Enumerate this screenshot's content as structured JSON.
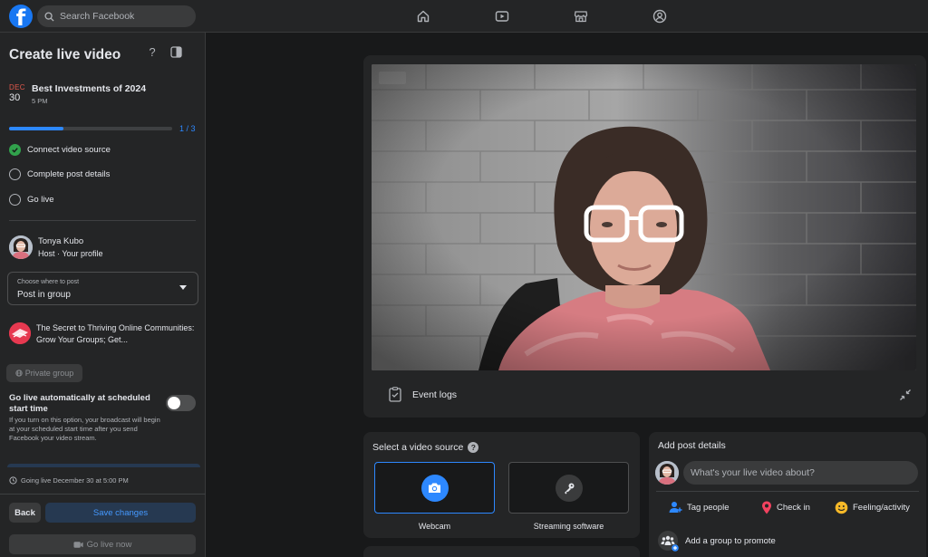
{
  "topbar": {
    "logo_letter": "f",
    "search_placeholder": "Search Facebook",
    "nav_icons": [
      "home-icon",
      "video-icon",
      "marketplace-icon",
      "groups-icon"
    ]
  },
  "sidebar": {
    "title": "Create live video",
    "help_label": "?",
    "event": {
      "month": "DEC",
      "day": "30",
      "name": "Best Investments of 2024",
      "time": "5 PM"
    },
    "progress": {
      "text": "1 / 3",
      "fraction": 0.3333
    },
    "steps": [
      {
        "label": "Connect video source",
        "done": true
      },
      {
        "label": "Complete post details",
        "done": false
      },
      {
        "label": "Go live",
        "done": false
      }
    ],
    "host": {
      "name": "Tonya Kubo",
      "role": "Host · Your profile"
    },
    "post_where": {
      "caption": "Choose where to post",
      "value": "Post in group"
    },
    "group": {
      "name": "The Secret to Thriving Online Communities: Grow Your Groups; Get..."
    },
    "private_label": "Private group",
    "auto_live": {
      "label": "Go live automatically at scheduled start time",
      "description": "If you turn on this option, your broadcast will begin at your scheduled start time after you send Facebook your video stream.",
      "enabled": false
    },
    "going_live": "Going live December 30 at 5:00 PM",
    "buttons": {
      "back": "Back",
      "save": "Save changes",
      "go_live": "Go live now"
    }
  },
  "preview": {
    "event_logs": "Event logs"
  },
  "video_source": {
    "title": "Select a video source",
    "help": "?",
    "options": [
      {
        "label": "Webcam",
        "selected": true
      },
      {
        "label": "Streaming software",
        "selected": false
      }
    ]
  },
  "post_details": {
    "title": "Add post details",
    "placeholder": "What's your live video about?",
    "actions": [
      {
        "label": "Tag people",
        "icon": "tag-people-icon"
      },
      {
        "label": "Check in",
        "icon": "location-pin-icon"
      },
      {
        "label": "Feeling/activity",
        "icon": "smiley-icon"
      }
    ],
    "promote": "Add a group to promote"
  },
  "colors": {
    "accent": "#2d88ff",
    "background": "#18191a",
    "card": "#242526",
    "success": "#31a24c",
    "danger_month": "#e0584b"
  }
}
